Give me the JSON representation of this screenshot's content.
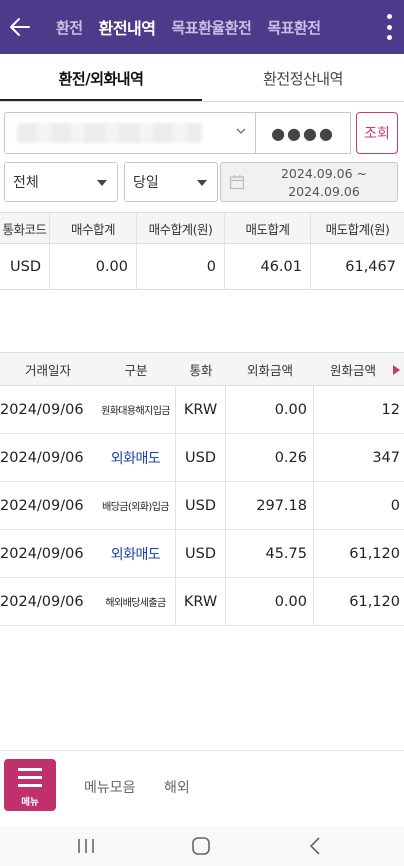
{
  "header": {
    "tabs": [
      {
        "label": "환전",
        "active": false
      },
      {
        "label": "환전내역",
        "active": true
      },
      {
        "label": "목표환율환전",
        "active": false
      },
      {
        "label": "목표환전",
        "active": false
      }
    ]
  },
  "subtabs": [
    {
      "label": "환전/외화내역",
      "active": true
    },
    {
      "label": "환전정산내역",
      "active": false
    }
  ],
  "search": {
    "password_mask": "●●●●",
    "lookup_label": "조회",
    "type_select": "전체",
    "period_select": "당일",
    "date_from": "2024.09.06 ~",
    "date_to": "2024.09.06"
  },
  "summary": {
    "headers": [
      "통화코드",
      "매수합계",
      "매수합계(원)",
      "매도합계",
      "매도합계(원)"
    ],
    "row": [
      "USD",
      "0.00",
      "0",
      "46.01",
      "61,467"
    ]
  },
  "transactions": {
    "headers": [
      "거래일자",
      "구분",
      "통화",
      "외화금액",
      "원화금액"
    ],
    "rows": [
      {
        "date": "2024/09/06",
        "kind": "원화대용해지입금",
        "kind_style": "small",
        "currency": "KRW",
        "fx": "0.00",
        "krw": "12"
      },
      {
        "date": "2024/09/06",
        "kind": "외화매도",
        "kind_style": "blue",
        "currency": "USD",
        "fx": "0.26",
        "krw": "347"
      },
      {
        "date": "2024/09/06",
        "kind": "배당금(외화)입금",
        "kind_style": "small",
        "currency": "USD",
        "fx": "297.18",
        "krw": "0"
      },
      {
        "date": "2024/09/06",
        "kind": "외화매도",
        "kind_style": "blue",
        "currency": "USD",
        "fx": "45.75",
        "krw": "61,120"
      },
      {
        "date": "2024/09/06",
        "kind": "해외배당세출금",
        "kind_style": "small",
        "currency": "KRW",
        "fx": "0.00",
        "krw": "61,120"
      }
    ]
  },
  "bottom_menu": {
    "menu_label": "메뉴",
    "links": [
      "메뉴모음",
      "해외"
    ]
  },
  "colors": {
    "header_bg": "#4b3b8a",
    "accent": "#c43d6b",
    "menu_button": "#c0306a",
    "sell_text": "#1b3fa8"
  }
}
